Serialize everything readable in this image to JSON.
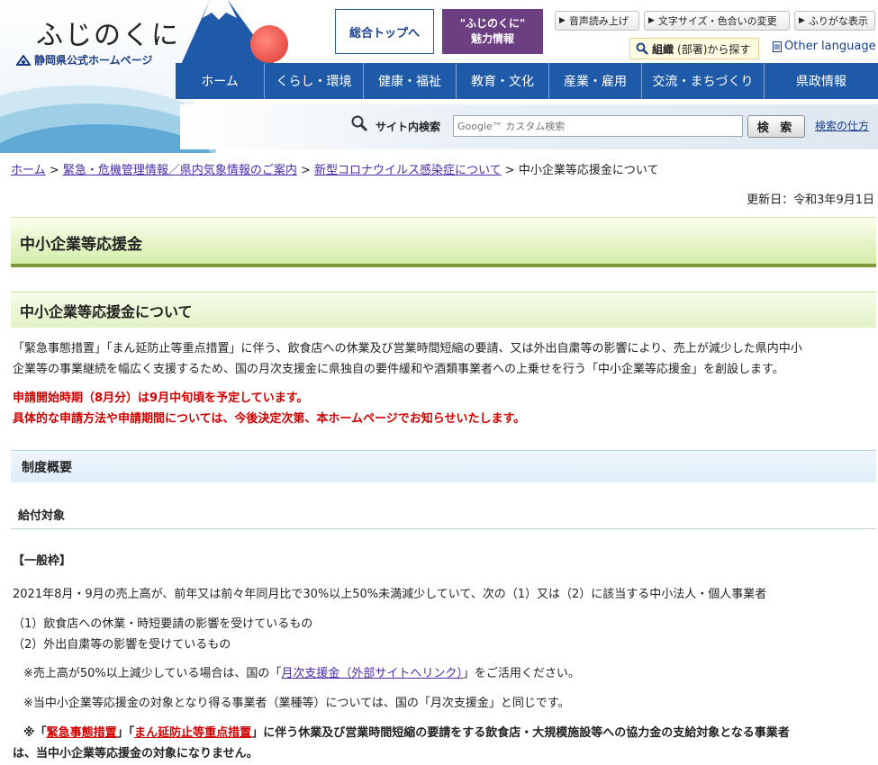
{
  "header": {
    "logo_title": "ふじのくに",
    "logo_sub": "静岡県公式ホームページ",
    "top_button": "総合トップへ",
    "miryoku_line1": "\"ふじのくに\"",
    "miryoku_line2": "魅力情報",
    "util": [
      "音声読み上げ",
      "文字サイズ・色合いの変更",
      "ふりがな表示"
    ],
    "org_search": "組織",
    "org_search_suffix": "(部署)から探す",
    "other_language": "Other language"
  },
  "nav": [
    "ホーム",
    "くらし・環境",
    "健康・福祉",
    "教育・文化",
    "産業・雇用",
    "交流・まちづくり",
    "県政情報"
  ],
  "search": {
    "label": "サイト内検索",
    "placeholder": "Google™ カスタム検索",
    "button": "検 索",
    "help": "検索の仕方"
  },
  "breadcrumb": {
    "items": [
      "ホーム",
      "緊急・危機管理情報／県内気象情報のご案内",
      "新型コロナウイルス感染症について"
    ],
    "current": "中小企業等応援金について",
    "separator": ">"
  },
  "updated": "更新日：令和3年9月1日",
  "page": {
    "title": "中小企業等応援金",
    "section_title": "中小企業等応援金について",
    "intro_line1": "「緊急事態措置」「まん延防止等重点措置」に伴う、飲食店への休業及び営業時間短縮の要請、又は外出自粛等の影響により、売上が減少した県内中小",
    "intro_line2": "企業等の事業継続を幅広く支援するため、国の月次支援金に県独自の要件緩和や酒類事業者への上乗せを行う「中小企業等応援金」を創設します。",
    "notice_line1": "申請開始時期（8月分）は9月中旬頃を予定しています。",
    "notice_line2": "具体的な申請方法や申請期間については、今後決定次第、本ホームページでお知らせいたします。",
    "overview_title": "制度概要",
    "target_title": "給付対象",
    "general_frame": "【一般枠】",
    "condition": "2021年8月・9月の売上高が、前年又は前々年同月比で30%以上50%未満減少していて、次の（1）又は（2）に該当する中小法人・個人事業者",
    "cond1": "（1）飲食店への休業・時短要請の影響を受けているもの",
    "cond2": "（2）外出自粛等の影響を受けているもの",
    "note1_prefix": "※売上高が50%以上減少している場合は、国の「",
    "note1_link": "月次支援金（外部サイトへリンク）",
    "note1_suffix": "」をご活用ください。",
    "note2": "※当中小企業等応援金の対象となり得る事業者（業種等）については、国の「月次支援金」と同じです。",
    "note3_prefix": "※「",
    "note3_link1": "緊急事態措置",
    "note3_mid": "」「",
    "note3_link2": "まん延防止等重点措置",
    "note3_suffix": "」に伴う休業及び営業時間短縮の要請をする飲食店・大規模施設等への協力金の支給対象となる事業者",
    "note3_line2": "は、当中小企業等応援金の対象になりません。"
  }
}
